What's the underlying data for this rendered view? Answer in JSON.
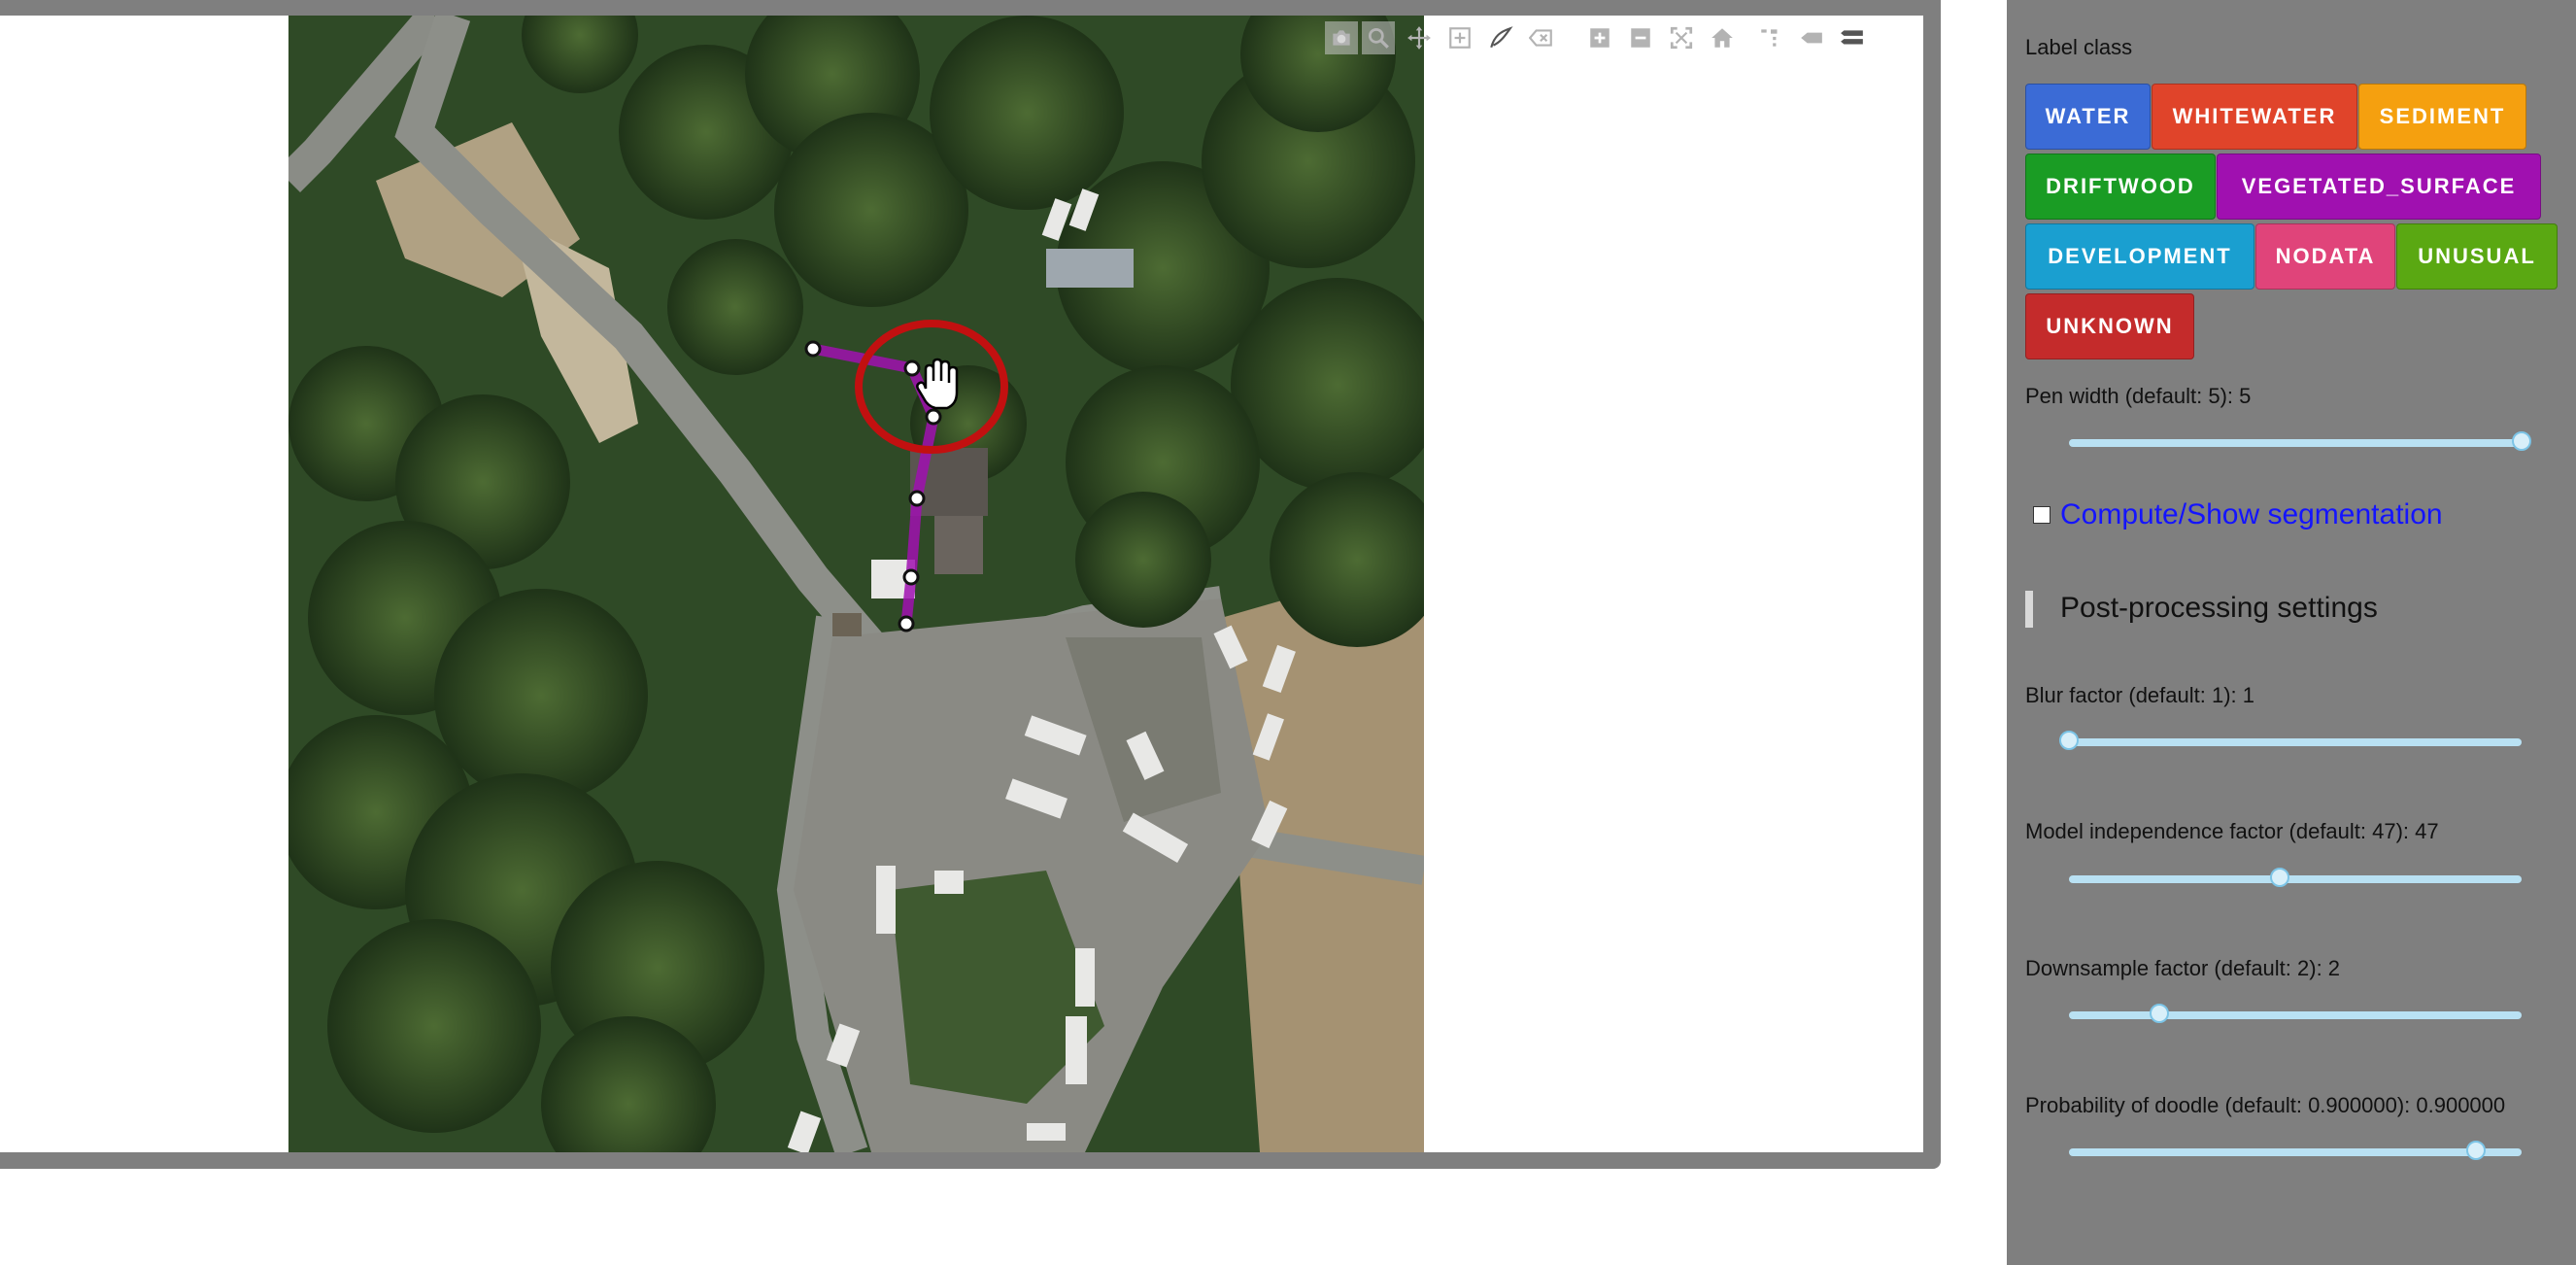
{
  "modebar": {
    "icons": [
      "camera-icon",
      "zoom-icon",
      "pan-icon",
      "box-select-icon",
      "draw-open-path-icon",
      "erase-shape-icon",
      "zoom-in-icon",
      "zoom-out-icon",
      "autoscale-icon",
      "reset-axes-icon",
      "toggle-spike-lines-icon",
      "hover-closest-icon",
      "hover-compare-icon"
    ]
  },
  "sidebar": {
    "label_class_title": "Label class",
    "classes": [
      {
        "label": "WATER",
        "color": "#3b6bd6"
      },
      {
        "label": "WHITEWATER",
        "color": "#e0442a"
      },
      {
        "label": "SEDIMENT",
        "color": "#f5a00f"
      },
      {
        "label": "DRIFTWOOD",
        "color": "#1a9c24"
      },
      {
        "label": "VEGETATED_SURFACE",
        "color": "#a010b0"
      },
      {
        "label": "DEVELOPMENT",
        "color": "#1a9fd0"
      },
      {
        "label": "NODATA",
        "color": "#e0447a"
      },
      {
        "label": "UNUSUAL",
        "color": "#5aa812"
      },
      {
        "label": "UNKNOWN",
        "color": "#c42b2b"
      }
    ],
    "pen_width_label": "Pen width (default: 5): 5",
    "pen_width_value": 5,
    "segmentation_link": "Compute/Show segmentation",
    "postprocessing_title": "Post-processing settings",
    "blur_label": "Blur factor (default: 1): 1",
    "blur_value": 1,
    "model_independence_label": "Model independence factor (default: 47): 47",
    "model_independence_value": 47,
    "downsample_label": "Downsample factor (default: 2): 2",
    "downsample_value": 2,
    "doodle_prob_label": "Probability of doodle (default: 0.900000): 0.900000",
    "doodle_prob_value": 0.9
  }
}
